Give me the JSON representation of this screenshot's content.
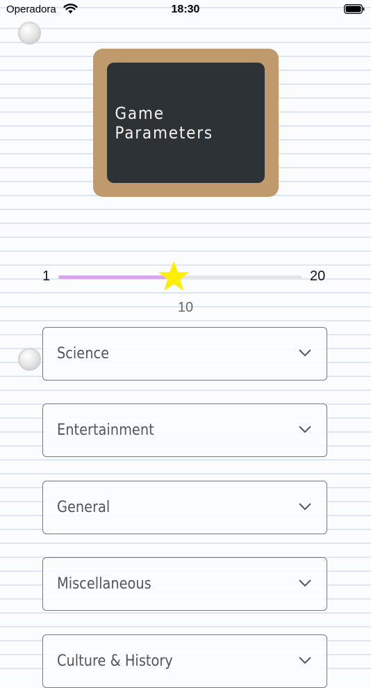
{
  "status_bar": {
    "carrier": "Operadora",
    "time": "18:30"
  },
  "board": {
    "title": "Game Parameters"
  },
  "slider": {
    "min_label": "1",
    "max_label": "20",
    "value_label": "10",
    "value": 10,
    "min": 1,
    "max": 20
  },
  "categories": [
    {
      "label": "Science"
    },
    {
      "label": "Entertainment"
    },
    {
      "label": "General"
    },
    {
      "label": "Miscellaneous"
    },
    {
      "label": "Culture & History"
    }
  ],
  "colors": {
    "board_frame": "#bf9a6d",
    "board": "#2c3236",
    "slider_fill": "#d8a6ec",
    "thumb_star": "#ffee00"
  },
  "icons": {
    "thumb": "star-icon",
    "dropdown": "chevron-down-icon"
  }
}
